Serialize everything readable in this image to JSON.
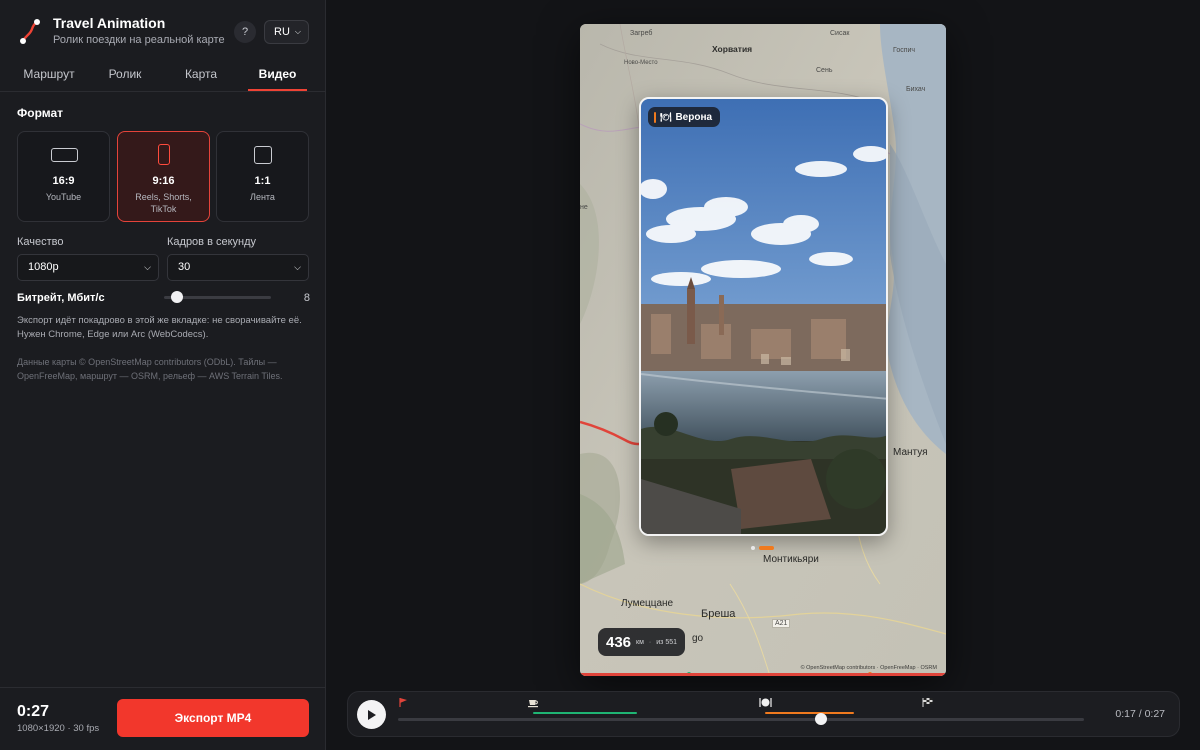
{
  "app": {
    "title": "Travel Animation",
    "subtitle": "Ролик поездки на реальной карте",
    "help_label": "?",
    "language": "RU"
  },
  "tabs": [
    {
      "label": "Маршрут",
      "active": false
    },
    {
      "label": "Ролик",
      "active": false
    },
    {
      "label": "Карта",
      "active": false
    },
    {
      "label": "Видео",
      "active": true
    }
  ],
  "format": {
    "title": "Формат",
    "options": [
      {
        "ratio": "16:9",
        "label": "YouTube",
        "selected": false
      },
      {
        "ratio": "9:16",
        "label": "Reels, Shorts, TikTok",
        "selected": true
      },
      {
        "ratio": "1:1",
        "label": "Лента",
        "selected": false
      }
    ]
  },
  "quality": {
    "label": "Качество",
    "value": "1080p"
  },
  "fps": {
    "label": "Кадров в секунду",
    "value": "30"
  },
  "bitrate": {
    "label": "Битрейт, Мбит/с",
    "value": "8",
    "level": 0.1
  },
  "note": "Экспорт идёт покадрово в этой же вкладке: не сворачивайте её. Нужен Chrome, Edge или Arc (WebCodecs).",
  "credits": "Данные карты © OpenStreetMap contributors (ODbL). Тайлы — OpenFreeMap, маршрут — OSRM, рельеф — AWS Terrain Tiles.",
  "footer": {
    "duration": "0:27",
    "meta": "1080×1920 · 30 fps",
    "export_label": "Экспорт MP4"
  },
  "preview": {
    "map_labels": {
      "zagreb": "Загреб",
      "croatia": "Хорватия",
      "novo_mesto": "Ново-Место",
      "sisak": "Сисак",
      "gospic": "Госпич",
      "senj": "Сень",
      "bihac": "Бихач",
      "edge_letters": "не",
      "mantua": "Мантуя",
      "montichiari": "Монтикьяри",
      "lumezzane": "Лумеццане",
      "brescia": "Бреша",
      "bergamo_partial": "go",
      "road_a21": "A21"
    },
    "place": {
      "name": "Верона",
      "icon": "plate-icon"
    },
    "slide_dots": {
      "count": 2,
      "active": 2
    },
    "distance": {
      "value": "436",
      "unit": "км",
      "separator": "·",
      "total": "из 551"
    },
    "attribution": "© OpenStreetMap contributors · OpenFreeMap · OSRM"
  },
  "timeline": {
    "time": "0:17 / 0:27",
    "progress": 0.617,
    "segment_colors": {
      "drive": "#1fb574",
      "food": "#f07a1e"
    },
    "markers": [
      "start-flag-icon",
      "coffee-icon",
      "plate-icon",
      "finish-flag-icon"
    ]
  },
  "colors": {
    "accent": "#f2372c",
    "orange": "#f07a1e",
    "green": "#1fb574",
    "background": "#131417",
    "sidebar": "#1b1c20"
  }
}
